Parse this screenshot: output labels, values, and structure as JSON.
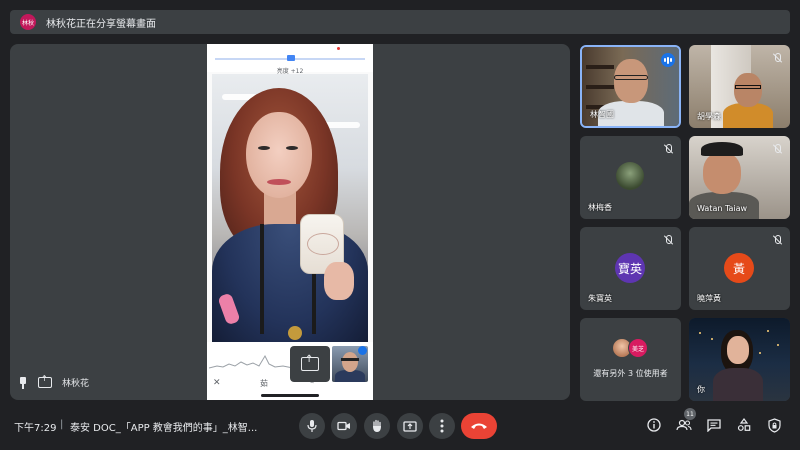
{
  "banner": {
    "avatar_text": "林秋",
    "text": "林秋花正在分享螢幕畫面"
  },
  "stage": {
    "presenter_name": "林秋花",
    "phone": {
      "zoom_label": "亮度 +12",
      "close_glyph": "✕",
      "text_glyph": "茹",
      "pen_glyph": "✎"
    }
  },
  "participants": [
    {
      "name": "林智國",
      "muted": false,
      "speaking": true
    },
    {
      "name": "胡學森",
      "muted": true
    },
    {
      "name": "林梅香",
      "muted": true
    },
    {
      "name": "Watan Taiaw",
      "muted": true
    },
    {
      "name": "朱寶英",
      "muted": true,
      "avatar_text": "寶英",
      "avatar_color": "#5e35b1"
    },
    {
      "name": "曉萍黃",
      "muted": true,
      "avatar_text": "黃",
      "avatar_color": "#e64a19"
    },
    {
      "others_text": "還有另外 3 位使用者",
      "avatar_text": "美芝"
    },
    {
      "name": "你"
    }
  ],
  "bottom": {
    "clock": "下午7:29",
    "separator": "|",
    "meeting_title": "泰安 DOC_「APP 教會我們的事」_林智...",
    "participant_count": "11",
    "accent_end_call": "#ea4335",
    "accent_active": "#8ab4f8"
  }
}
